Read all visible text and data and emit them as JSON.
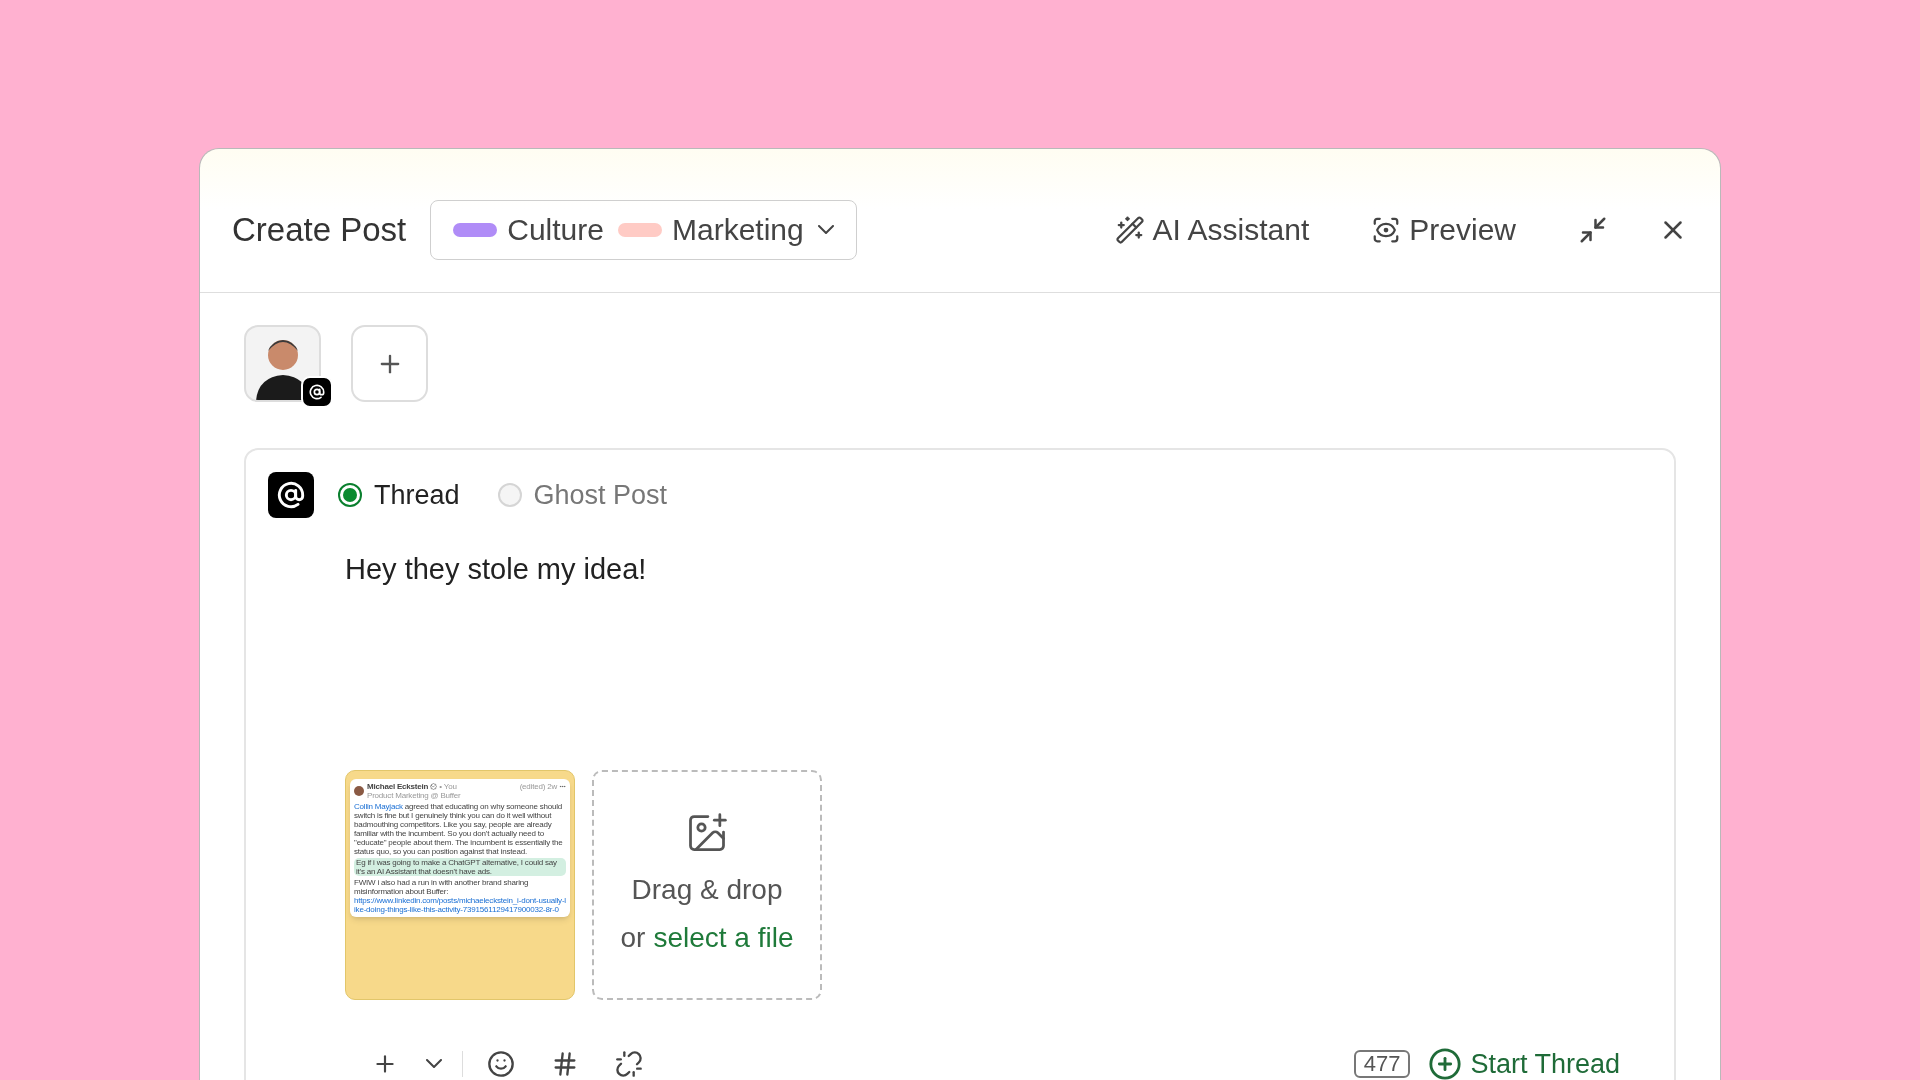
{
  "header": {
    "title": "Create Post",
    "tags": [
      {
        "label": "Culture",
        "color": "#b08cf7"
      },
      {
        "label": "Marketing",
        "color": "#ffcbc5"
      }
    ],
    "actions": [
      {
        "label": "AI Assistant",
        "kind": "ai"
      },
      {
        "label": "Preview",
        "kind": "preview"
      }
    ]
  },
  "composer": {
    "post_types": [
      {
        "label": "Thread",
        "selected": true
      },
      {
        "label": "Ghost Post",
        "selected": false
      }
    ],
    "text": "Hey they stole my idea!",
    "attachment": {
      "author": "Michael Eckstein",
      "badge": "• You",
      "subtitle": "Product Marketing @ Buffer",
      "time": "(edited) 2w",
      "mention": "Collin Mayjack",
      "body": "agreed that educating on why someone should switch is fine but I genuinely think you can do it well without badmouthing competitors. Like you say, people are already familiar with the incumbent. So you don't actually need to \"educate\" people about them. The incumbent is essentially the status quo, so you can position against that instead.",
      "highlight": "Eg if i was going to make a ChatGPT alternative, I could say it's an AI Assistant that doesn't have ads.",
      "footer": "FWIW i also had a run in with another brand sharing misinformation about Buffer:",
      "url": "https://www.linkedin.com/posts/michaeleckstein_i-dont-usually-like-doing-things-like-this-activity-7391561129417900032-8r-0"
    },
    "dropzone": {
      "title": "Drag & drop",
      "prefix": "or",
      "link": "select a file"
    },
    "toolbar": {
      "char_count": "477",
      "start_thread": "Start Thread"
    }
  }
}
